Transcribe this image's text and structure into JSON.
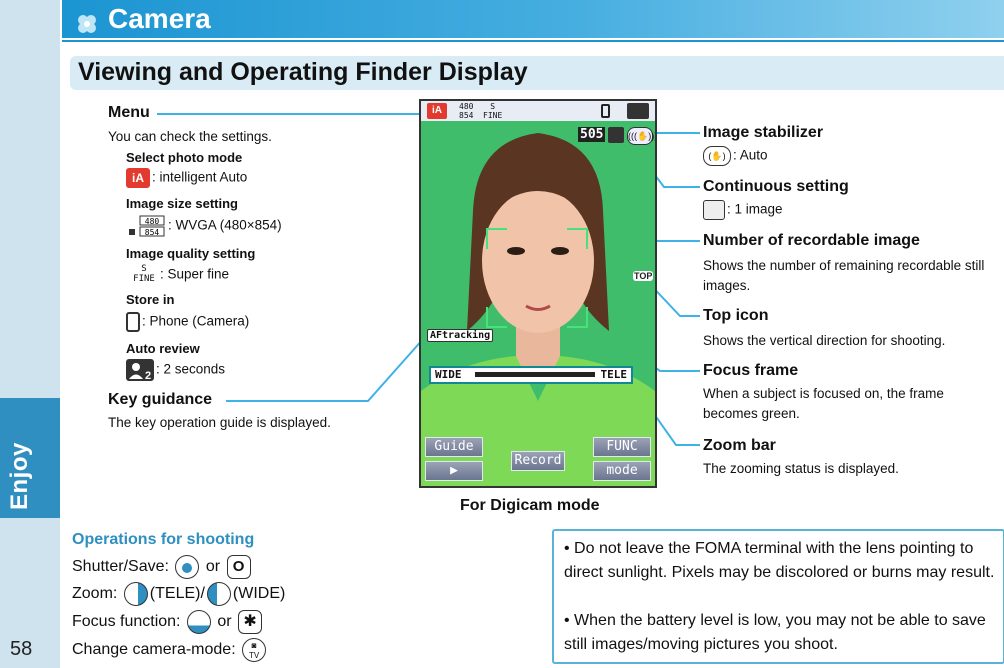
{
  "sidebar": {
    "section": "Enjoy",
    "page_number": "58"
  },
  "header": {
    "title": "Camera",
    "section_title": "Viewing and Operating Finder Display"
  },
  "menu": {
    "label": "Menu",
    "desc": "You can check the settings.",
    "items": [
      {
        "title": "Select photo mode",
        "value": ": intelligent Auto",
        "icon": "intelligent-auto-icon"
      },
      {
        "title": "Image size setting",
        "value": ": WVGA (480×854)",
        "icon": "image-size-icon"
      },
      {
        "title": "Image quality setting",
        "value": ": Super fine",
        "icon": "image-quality-icon"
      },
      {
        "title": "Store in",
        "value": ": Phone (Camera)",
        "icon": "phone-storage-icon"
      },
      {
        "title": "Auto review",
        "value": ": 2 seconds",
        "icon": "auto-review-icon"
      }
    ]
  },
  "key_guidance": {
    "label": "Key guidance",
    "desc": "The key operation guide is displayed."
  },
  "right_callouts": [
    {
      "label": "Image stabilizer",
      "value": ": Auto",
      "icon": "stabilizer-icon"
    },
    {
      "label": "Continuous setting",
      "value": ": 1 image",
      "icon": "camera-1-icon"
    },
    {
      "label": "Number of recordable image",
      "desc": "Shows the number of remaining recordable still images."
    },
    {
      "label": "Top icon",
      "desc": "Shows the vertical direction for shooting."
    },
    {
      "label": "Focus frame",
      "desc": "When a subject is focused on, the frame becomes green."
    },
    {
      "label": "Zoom bar",
      "desc": "The zooming status is displayed."
    }
  ],
  "phone_screen": {
    "size_top": "480",
    "size_bottom": "854",
    "quality": "FINE",
    "counter": "505",
    "af_tracking": "AFtracking",
    "top_icon": "TOP",
    "zoom_wide": "WIDE",
    "zoom_tele": "TELE",
    "soft_keys": [
      "Guide",
      "FUNC",
      "▶",
      "Record",
      "mode"
    ],
    "caption": "For Digicam mode"
  },
  "operations": {
    "title": "Operations for shooting",
    "lines": [
      {
        "label": "Shutter/Save:",
        "or": "or"
      },
      {
        "label": "Zoom:",
        "tele": "(TELE)/",
        "wide": "(WIDE)"
      },
      {
        "label": "Focus function:",
        "or": "or"
      },
      {
        "label": "Change camera-mode:"
      }
    ],
    "key_tv": "TV"
  },
  "notes": [
    "• Do not leave the FOMA terminal with the lens pointing to direct sunlight. Pixels may be discolored or burns may result.",
    "• When the battery level is low, you may not be able to save still images/moving pictures you shoot."
  ],
  "colors": {
    "accent": "#2e8fc0",
    "header": "#1b95d2",
    "callout_line": "#3fb2e6",
    "screen_bg": "#3dbb6a"
  }
}
